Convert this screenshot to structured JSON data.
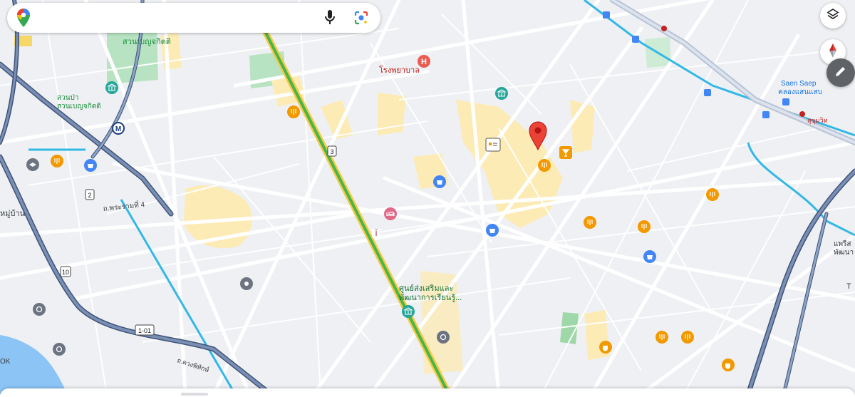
{
  "search": {
    "placeholder": "",
    "value": ""
  },
  "icons": {
    "logo": "google-maps-logo-icon",
    "mic": "microphone-icon",
    "lens": "google-lens-icon",
    "layers": "layers-icon",
    "compass": "compass-icon",
    "edit": "pencil-icon"
  },
  "map_labels": {
    "park": "สวนเบญจกิตติ",
    "park_area": "สวนป่า\nสวนเบญจกิตติ",
    "hospital": "โรงพยาบาล",
    "rama4_road": "ถ.พระรามที่ 4",
    "village": "หมู่บ้าน",
    "saen_saep_en": "Saen Saep",
    "saen_saep_th": "คลองแสนแสบ",
    "learning_center_1": "ศูนย์ส่งเสริมและ",
    "learning_center_2": "พัฒนาการเรียนรู้...",
    "right_edge_1": "แพรีส",
    "right_edge_2": "พัฒนา",
    "right_small": "สุขุมวิท",
    "route_10": "10",
    "route_101": "1-01",
    "route_3": "3",
    "route_2": "2",
    "road_bottom": "ถ.ดวงพิทักษ์",
    "letter_k": "OK",
    "letter_t": "T"
  },
  "colors": {
    "background": "#eef0f3",
    "minor_road": "#ffffff",
    "highway": "#5b7398",
    "highway_casing": "#3e5479",
    "commercial_area": "#fdebb5",
    "park": "#b7e3c2",
    "water": "#8bc4f5",
    "canal": "#33b8e6",
    "rail_green": "#45b649",
    "rail_yellow": "#f7c948",
    "marker_red": "#ea4335",
    "food_orange": "#f29900",
    "shopping_blue": "#4285f4",
    "hotel_pink": "#e06989",
    "museum_teal": "#26a69a",
    "grey_poi": "#6b7480"
  }
}
